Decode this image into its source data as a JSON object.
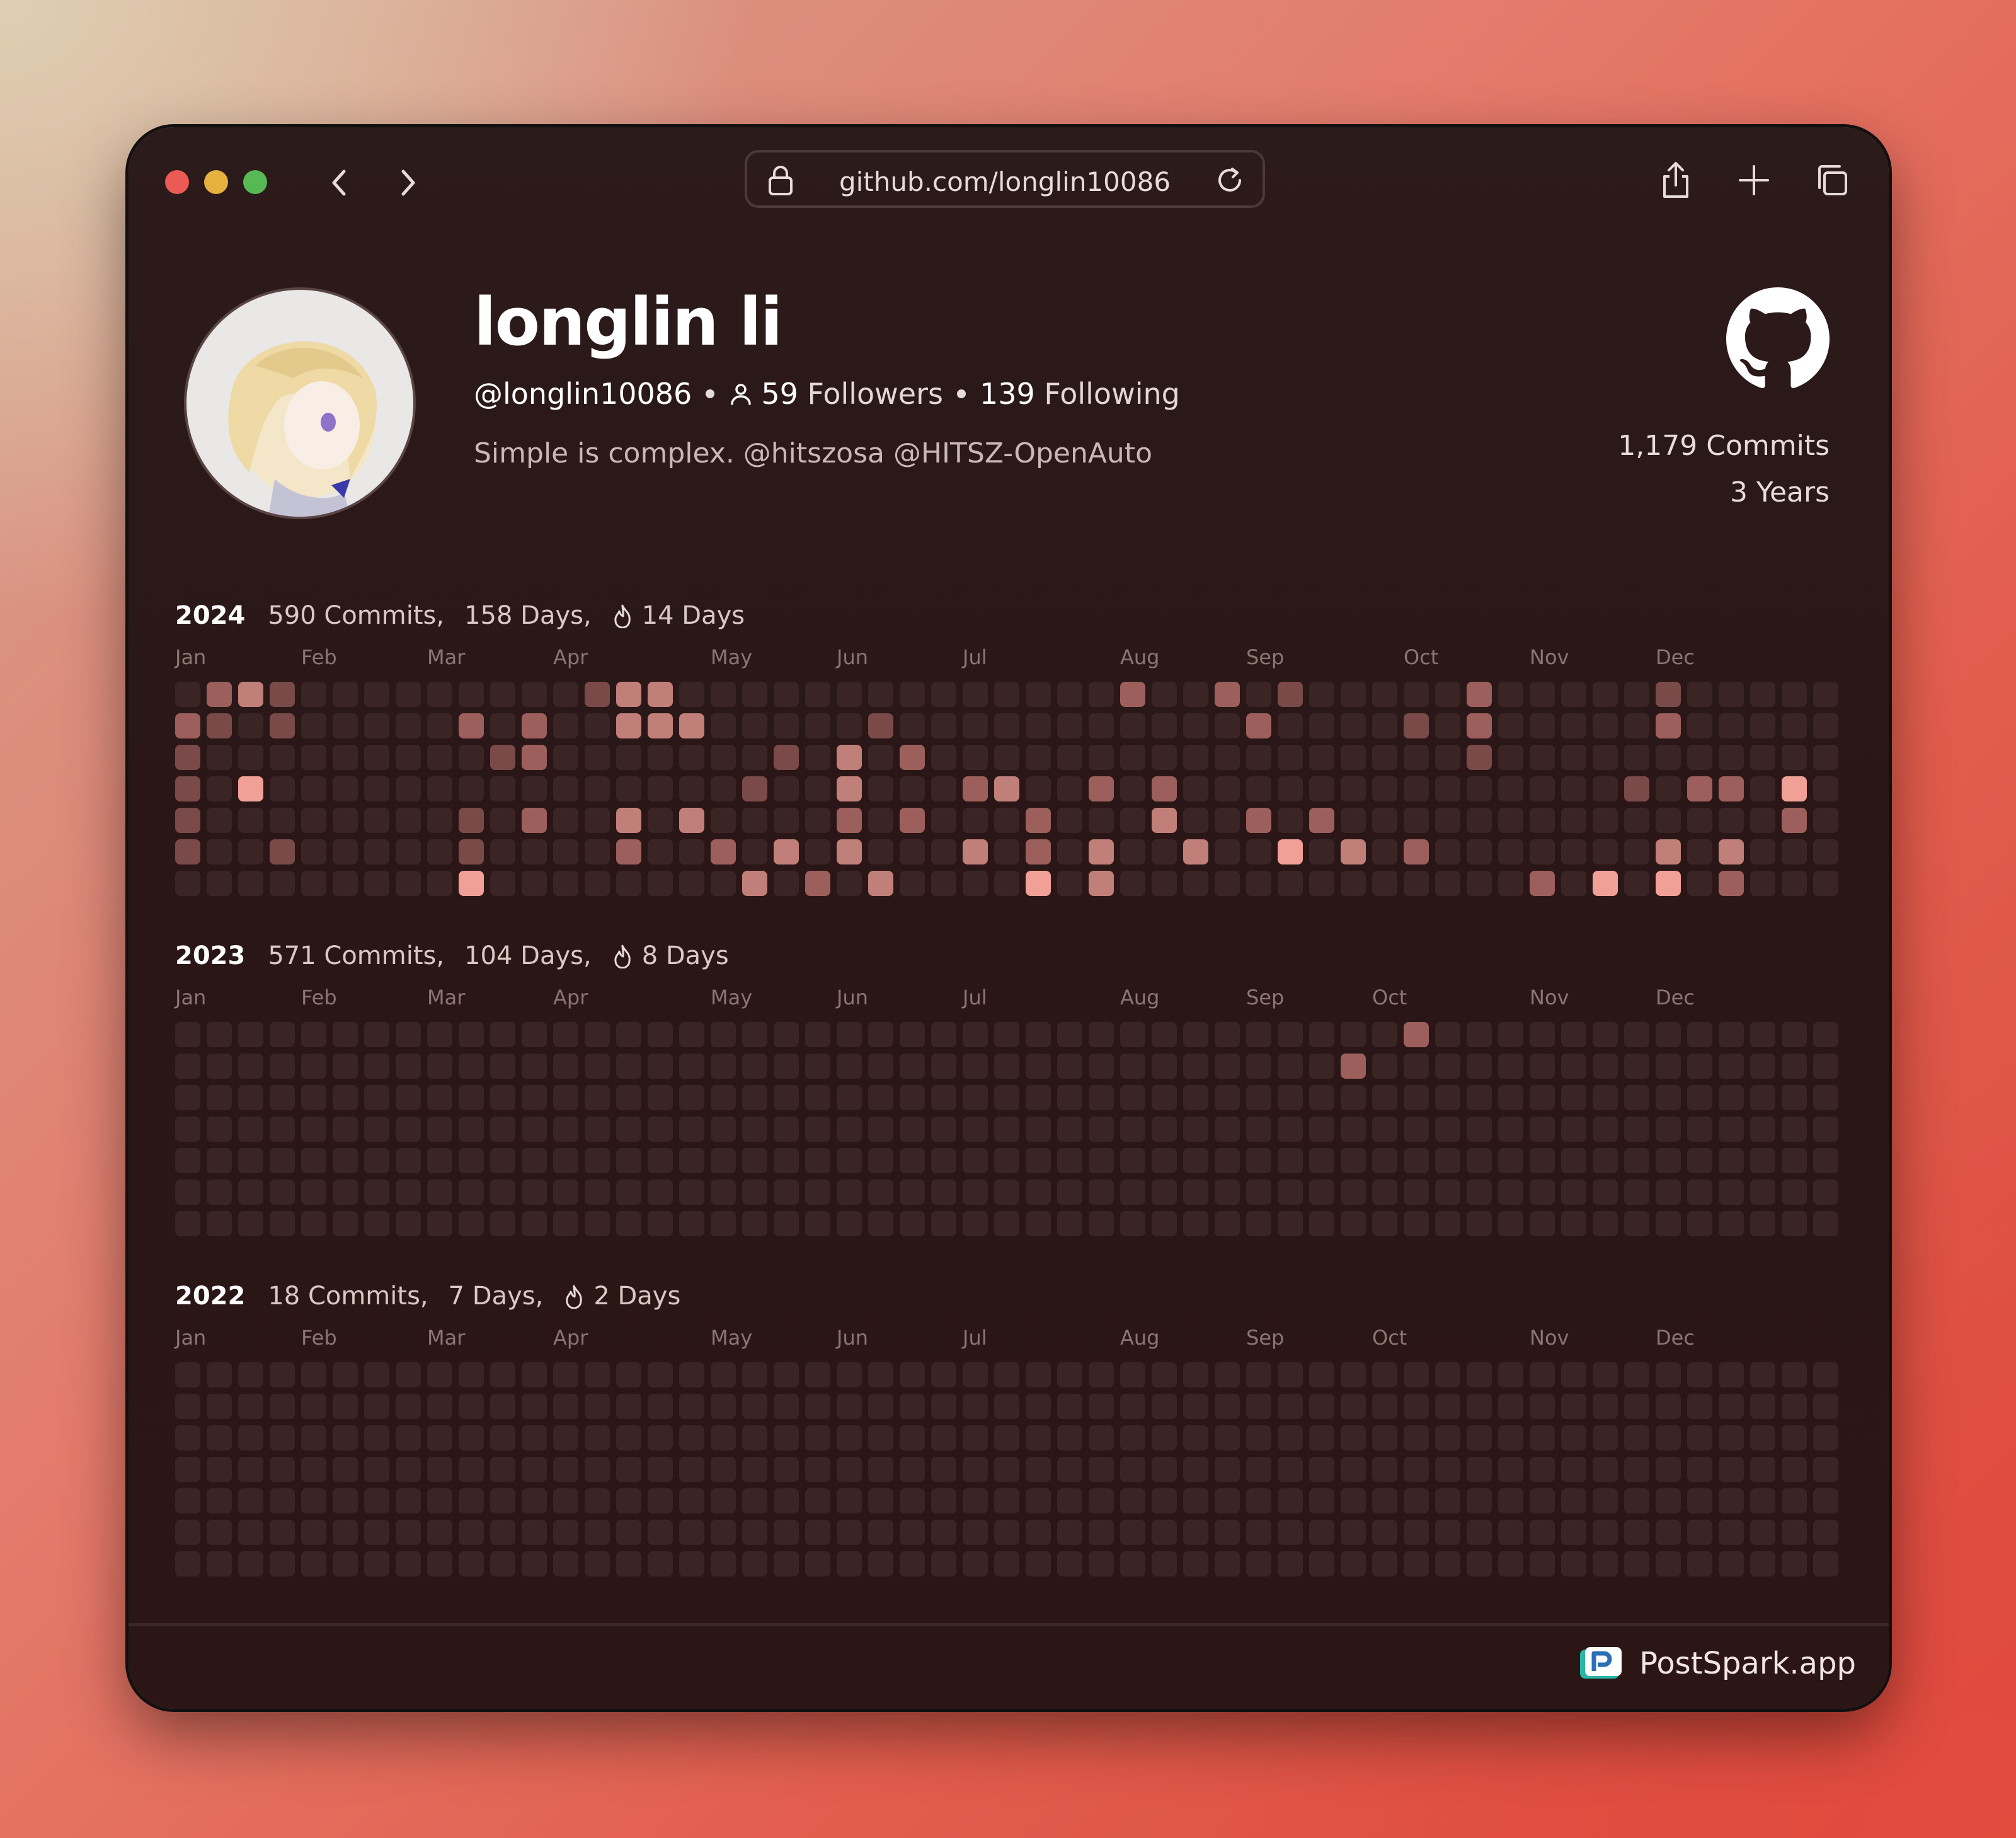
{
  "browser": {
    "url": "github.com/longlin10086",
    "icons": [
      "lock-icon",
      "reload-icon",
      "share-icon",
      "new-tab-icon",
      "tabs-icon",
      "back-icon",
      "forward-icon"
    ]
  },
  "profile": {
    "name": "longlin li",
    "handle": "@longlin10086",
    "followers_count": "59",
    "followers_label": "Followers",
    "following_count": "139",
    "following_label": "Following",
    "bio": "Simple is complex. @hitszosa @HITSZ-OpenAuto",
    "commits_total": "1,179 Commits",
    "years": "3 Years"
  },
  "colors": {
    "empty": "#3a2424",
    "level1": "#7a4a48",
    "level2": "#9c5f5c",
    "level3": "#c17f79",
    "level4": "#f0a096"
  },
  "years": [
    {
      "year": "2024",
      "commits": "590 Commits,",
      "days": "158 Days,",
      "streak": "14 Days",
      "months": [
        "Jan",
        "Feb",
        "Mar",
        "Apr",
        "May",
        "Jun",
        "Jul",
        "Aug",
        "Sep",
        "Oct",
        "Nov",
        "Dec"
      ],
      "month_weeks": [
        0,
        4,
        8,
        12,
        17,
        21,
        25,
        30,
        34,
        39,
        43,
        47
      ],
      "rows": [
        "-231---------133--------------2--2-1-----2-----1-----1---------------3--------2---122-1",
        "21-1-----2-2--333-----1-----------2----1-2-----2------------1-1-2-3---1-2-2-11-3---2--3-",
        "1---------12-------1-3-2-----------------1----------------22-1--2-4-2-----------2--2-2---",
        "1-4---------------1--3---23--2-2--------------1-22-4-----------------------2-2-22--22-22",
        "1--------1-2--3-3----2-2---2---3--2-2--------------2-----------------------2-3--12-3-1",
        "1--1-----1----2--2-3-3---3-2-3--3--4-3-2-------3-3---------------1-1--2-1----1-3-3----1-3-2",
        "---------4--------3-2-3----4-3-------------2-4-4-2-------------------------2--2-----2-"
      ]
    },
    {
      "year": "2023",
      "commits": "571 Commits,",
      "days": "104 Days,",
      "streak": "8 Days",
      "months": [
        "Jan",
        "Feb",
        "Mar",
        "Apr",
        "May",
        "Jun",
        "Jul",
        "Aug",
        "Sep",
        "Oct",
        "Nov",
        "Dec"
      ],
      "month_weeks": [
        0,
        4,
        8,
        12,
        17,
        21,
        25,
        30,
        34,
        38,
        43,
        47
      ],
      "rows": [
        "---------------------------------------2",
        "-------------------------------------2",
        "--------------------------------------",
        "--------------------------------------",
        "--------------------------------------",
        "-------------------------------------",
        "--------------------------------------"
      ]
    },
    {
      "year": "2022",
      "commits": "18 Commits,",
      "days": "7 Days,",
      "streak": "2 Days",
      "months": [
        "Jan",
        "Feb",
        "Mar",
        "Apr",
        "May",
        "Jun",
        "Jul",
        "Aug",
        "Sep",
        "Oct",
        "Nov",
        "Dec"
      ],
      "month_weeks": [
        0,
        4,
        8,
        12,
        17,
        21,
        25,
        30,
        34,
        38,
        43,
        47
      ],
      "rows": []
    }
  ],
  "footer": {
    "brand": "PostSpark.app"
  }
}
